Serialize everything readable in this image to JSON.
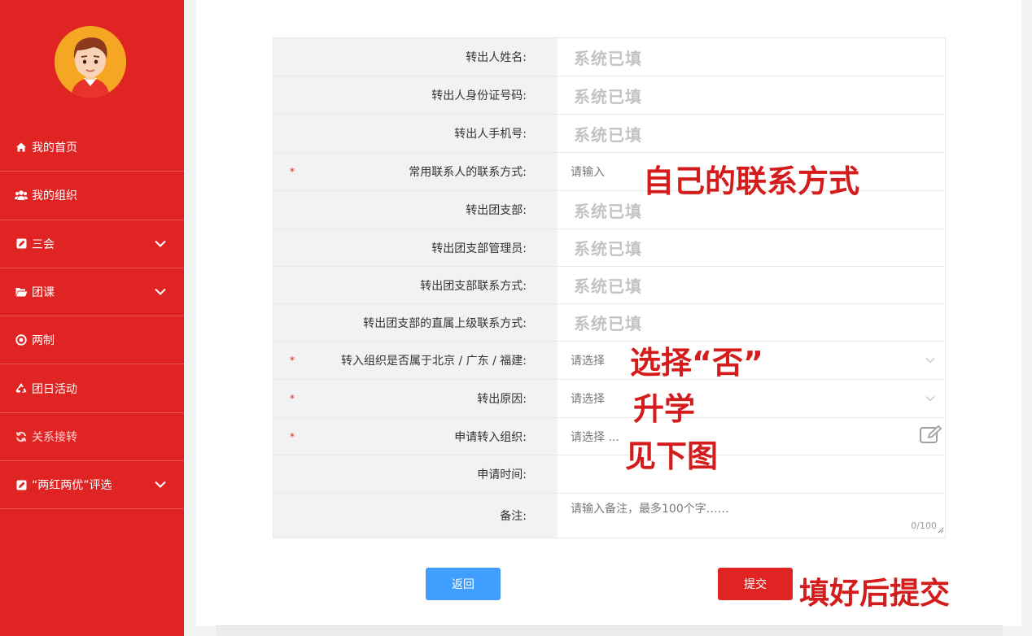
{
  "sidebar": {
    "items": [
      {
        "label": "我的首页",
        "icon": "home-icon",
        "has_chevron": false
      },
      {
        "label": "我的组织",
        "icon": "users-icon",
        "has_chevron": false
      },
      {
        "label": "三会",
        "icon": "edit-icon",
        "has_chevron": true
      },
      {
        "label": "团课",
        "icon": "folder-open-icon",
        "has_chevron": true
      },
      {
        "label": "两制",
        "icon": "target-icon",
        "has_chevron": false
      },
      {
        "label": "团日活动",
        "icon": "recycle-icon",
        "has_chevron": false
      },
      {
        "label": "关系接转",
        "icon": "refresh-icon",
        "has_chevron": false,
        "active": true
      },
      {
        "label": "“两红两优”评选",
        "icon": "edit-icon",
        "has_chevron": true
      }
    ]
  },
  "form": {
    "rows": [
      {
        "label": "转出人姓名:",
        "value": "系统已填",
        "type": "filled"
      },
      {
        "label": "转出人身份证号码:",
        "value": "系统已填",
        "type": "filled"
      },
      {
        "label": "转出人手机号:",
        "value": "系统已填",
        "type": "filled"
      },
      {
        "label": "常用联系人的联系方式:",
        "placeholder": "请输入",
        "type": "input",
        "required": true
      },
      {
        "label": "转出团支部:",
        "value": "系统已填",
        "type": "filled"
      },
      {
        "label": "转出团支部管理员:",
        "value": "系统已填",
        "type": "filled"
      },
      {
        "label": "转出团支部联系方式:",
        "value": "系统已填",
        "type": "filled"
      },
      {
        "label": "转出团支部的直属上级联系方式:",
        "value": "系统已填",
        "type": "filled"
      },
      {
        "label": "转入组织是否属于北京 / 广东 / 福建:",
        "placeholder": "请选择",
        "type": "select",
        "required": true
      },
      {
        "label": "转出原因:",
        "placeholder": "请选择",
        "type": "select",
        "required": true
      },
      {
        "label": "申请转入组织:",
        "placeholder": "请选择 ...",
        "type": "picker",
        "required": true
      },
      {
        "label": "申请时间:",
        "type": "empty"
      },
      {
        "label": "备注:",
        "placeholder": "请输入备注，最多100个字……",
        "type": "textarea",
        "counter": "0/100"
      }
    ]
  },
  "annotations": {
    "contact": "自己的联系方式",
    "choose_no": "选择“否”",
    "reason": "升学",
    "see_below": "见下图",
    "submit_hint": "填好后提交"
  },
  "buttons": {
    "back": "返回",
    "submit": "提交"
  },
  "colors": {
    "brand": "#e02424",
    "primary": "#409eff",
    "annotation": "#d41c1c"
  }
}
